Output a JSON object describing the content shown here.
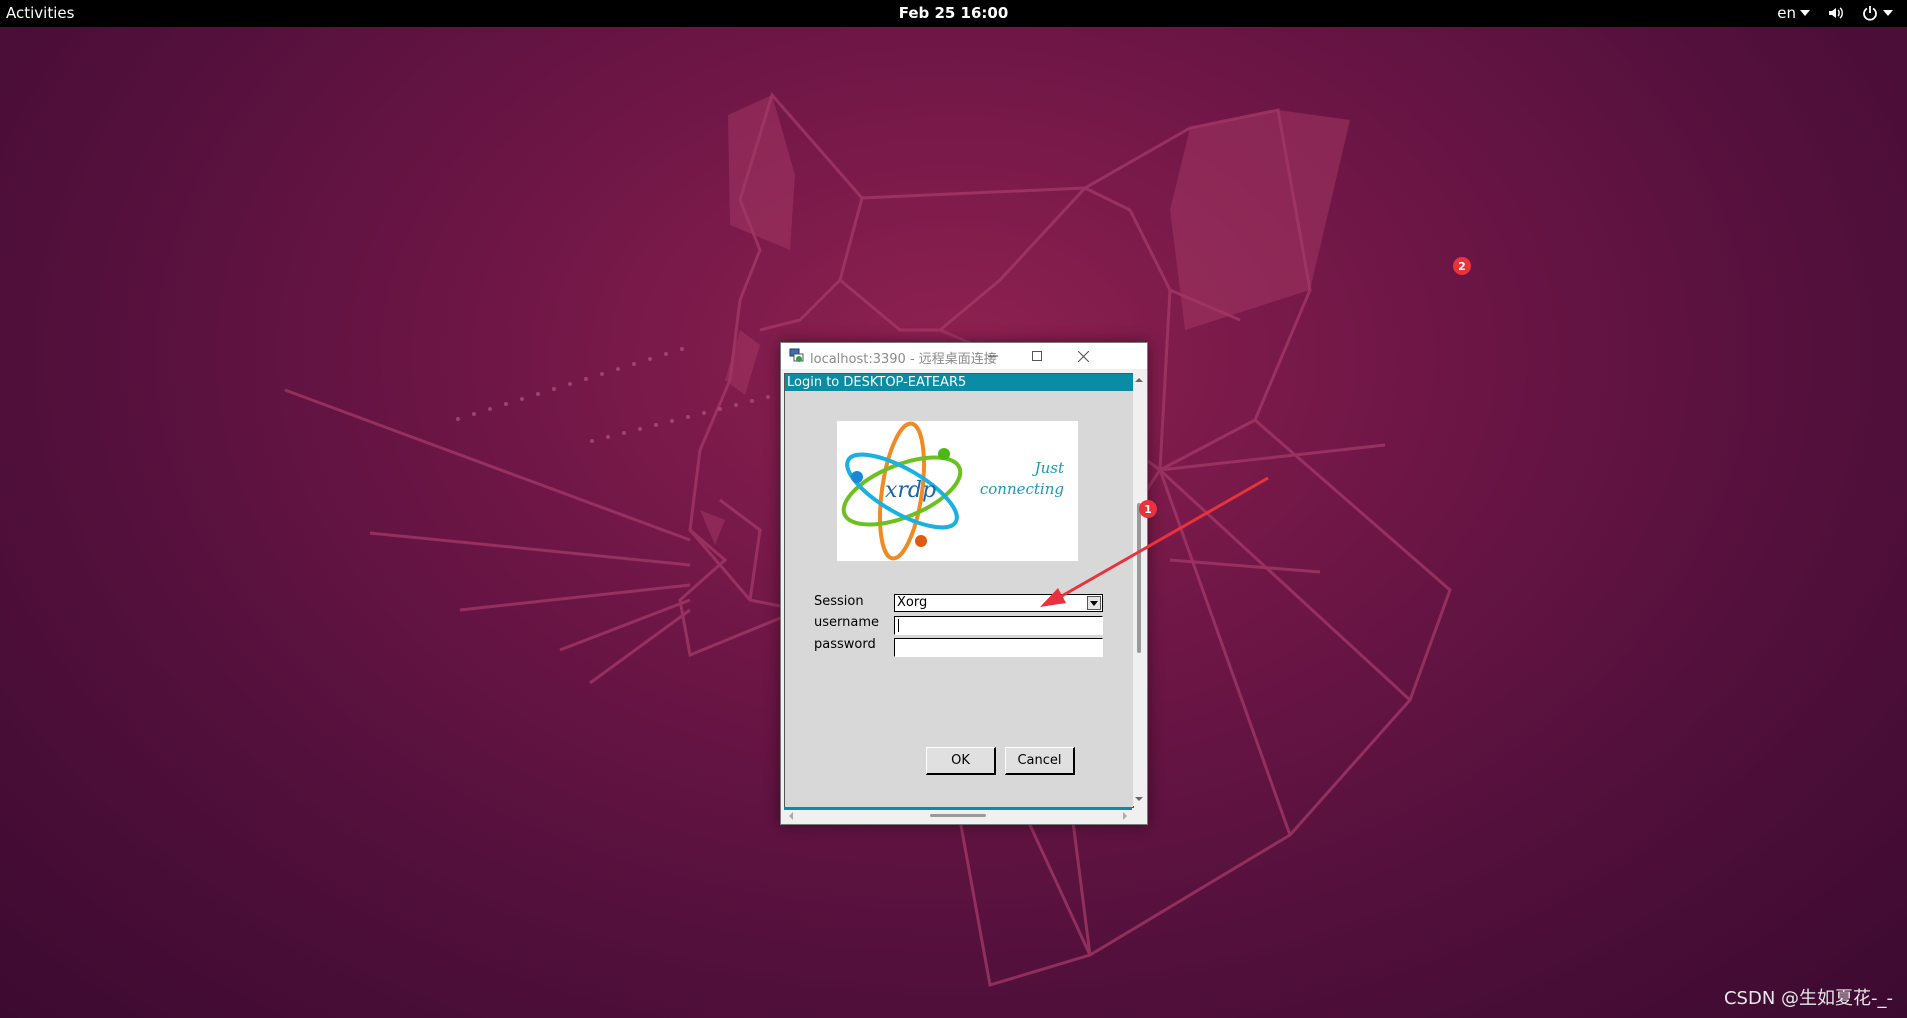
{
  "topbar": {
    "activities": "Activities",
    "clock": "Feb 25  16:00",
    "language": "en"
  },
  "rdp_window": {
    "title": "localhost:3390 - 远程桌面连接",
    "icon": "remote-desktop-icon"
  },
  "xrdp": {
    "header": "Login to DESKTOP-EATEAR5",
    "logo": {
      "name": "xrdp",
      "tagline_1": "Just",
      "tagline_2": "connecting"
    },
    "session_label": "Session",
    "session_value": "Xorg",
    "username_label": "username",
    "username_value": "",
    "password_label": "password",
    "password_value": "",
    "ok_label": "OK",
    "cancel_label": "Cancel"
  },
  "annotations": {
    "badge_1": "1",
    "badge_2": "2",
    "arrow_color": "#e8323c"
  },
  "watermark": "CSDN @生如夏花-_-",
  "colors": {
    "xrdp_accent": "#0a8ca4",
    "badge": "#e8323c"
  }
}
